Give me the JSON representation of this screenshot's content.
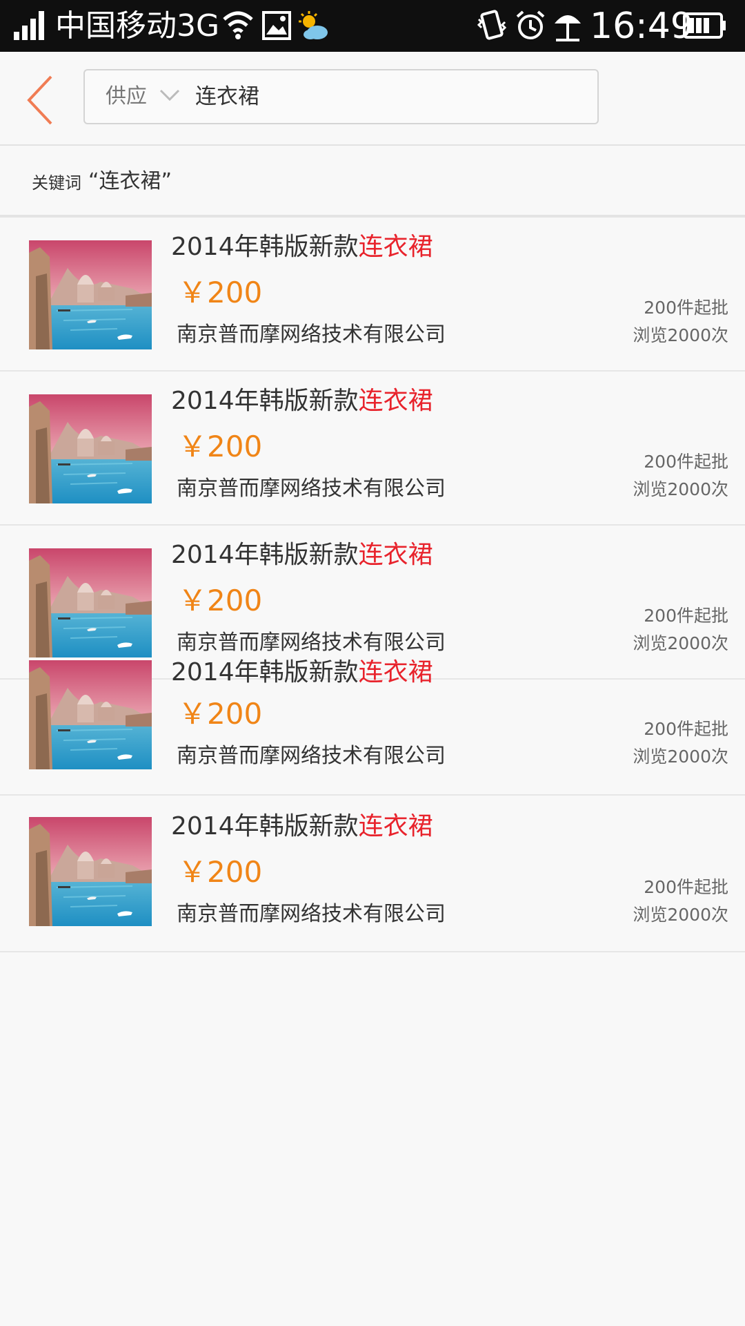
{
  "status_bar": {
    "carrier": "中国移动3G",
    "time": "16:49",
    "icons": [
      "signal-icon",
      "wifi-icon",
      "image-icon",
      "weather-icon",
      "vibrate-icon",
      "alarm-icon",
      "beach-icon",
      "battery-icon"
    ]
  },
  "header": {
    "back_icon": "chevron-left-icon",
    "scope": "供应",
    "scope_icon": "chevron-down-icon",
    "query": "连衣裙"
  },
  "keyword_bar": {
    "label": "关键词",
    "value": "“连衣裙”"
  },
  "results": [
    {
      "title_prefix": "2014年韩版新款",
      "title_highlight": "连衣裙",
      "price": "￥200",
      "company": "南京普而摩网络技术有限公司",
      "moq": "200件起批",
      "views": "浏览2000次"
    },
    {
      "title_prefix": "2014年韩版新款",
      "title_highlight": "连衣裙",
      "price": "￥200",
      "company": "南京普而摩网络技术有限公司",
      "moq": "200件起批",
      "views": "浏览2000次"
    },
    {
      "title_prefix": "2014年韩版新款",
      "title_highlight": "连衣裙",
      "price": "￥200",
      "company": "南京普而摩网络技术有限公司",
      "moq": "200件起批",
      "views": "浏览2000次"
    },
    {
      "title_prefix": "2014年韩版新款",
      "title_highlight": "连衣裙",
      "price": "￥200",
      "company": "南京普而摩网络技术有限公司",
      "moq": "200件起批",
      "views": "浏览2000次"
    },
    {
      "title_prefix": "2014年韩版新款",
      "title_highlight": "连衣裙",
      "price": "￥200",
      "company": "南京普而摩网络技术有限公司",
      "moq": "200件起批",
      "views": "浏览2000次"
    }
  ],
  "colors": {
    "accent_back": "#f07c54",
    "price": "#f08517",
    "highlight": "#e8232c",
    "status_bar_bg": "#0f0f0f"
  }
}
